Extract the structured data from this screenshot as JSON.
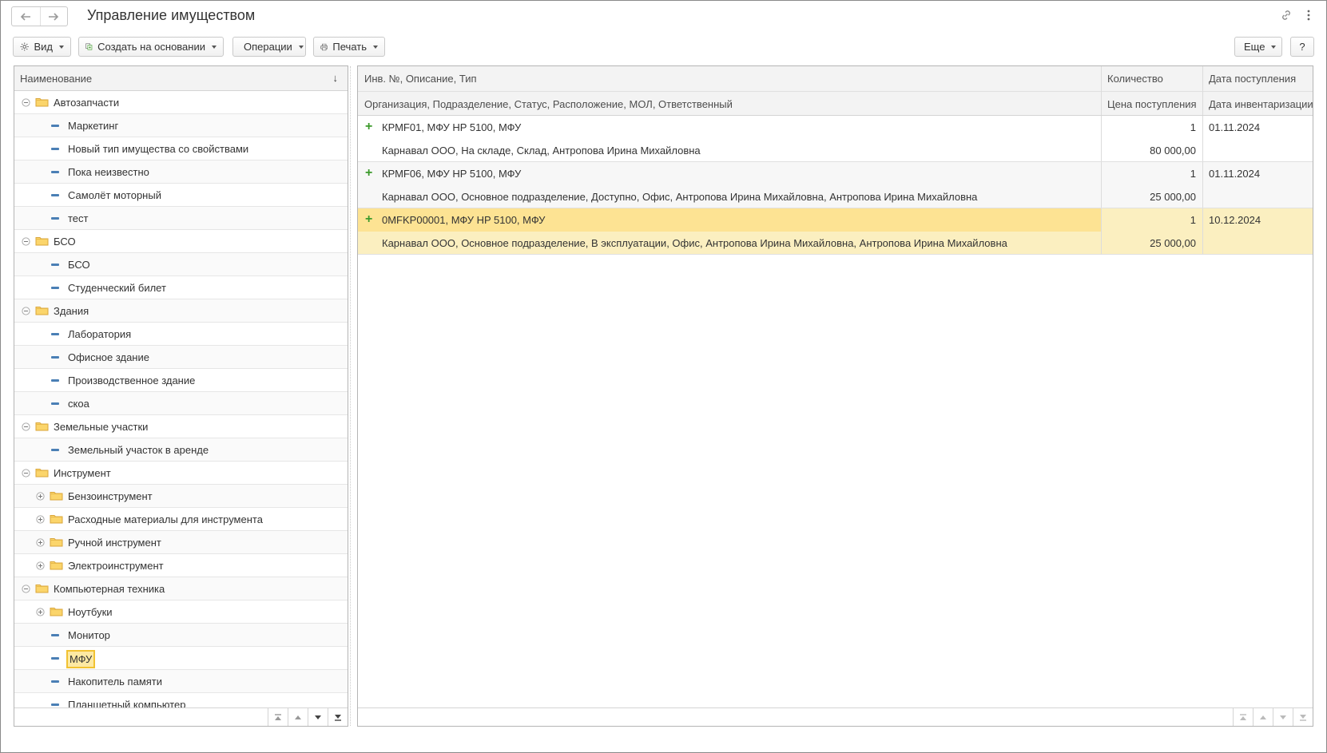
{
  "window": {
    "title": "Управление имуществом"
  },
  "toolbar": {
    "view_label": "Вид",
    "create_based_label": "Создать на основании",
    "operations_label": "Операции",
    "print_label": "Печать",
    "more_label": "Еще",
    "help_label": "?"
  },
  "tree": {
    "header": "Наименование",
    "sort_indicator": "↓",
    "items": [
      {
        "level": 0,
        "type": "folder",
        "state": "expanded",
        "label": "Автозапчасти"
      },
      {
        "level": 1,
        "type": "item",
        "label": "Маркетинг"
      },
      {
        "level": 1,
        "type": "item",
        "label": "Новый тип имущества со свойствами"
      },
      {
        "level": 1,
        "type": "item",
        "label": "Пока неизвестно"
      },
      {
        "level": 1,
        "type": "item",
        "label": "Самолёт моторный"
      },
      {
        "level": 1,
        "type": "item",
        "label": "тест"
      },
      {
        "level": 0,
        "type": "folder",
        "state": "expanded",
        "label": "БСО"
      },
      {
        "level": 1,
        "type": "item",
        "label": "БСО"
      },
      {
        "level": 1,
        "type": "item",
        "label": "Студенческий билет"
      },
      {
        "level": 0,
        "type": "folder",
        "state": "expanded",
        "label": "Здания"
      },
      {
        "level": 1,
        "type": "item",
        "label": "Лаборатория"
      },
      {
        "level": 1,
        "type": "item",
        "label": "Офисное здание"
      },
      {
        "level": 1,
        "type": "item",
        "label": "Производственное здание"
      },
      {
        "level": 1,
        "type": "item",
        "label": "скоа"
      },
      {
        "level": 0,
        "type": "folder",
        "state": "expanded",
        "label": "Земельные участки"
      },
      {
        "level": 1,
        "type": "item",
        "label": "Земельный участок в аренде"
      },
      {
        "level": 0,
        "type": "folder",
        "state": "expanded",
        "label": "Инструмент"
      },
      {
        "level": 1,
        "type": "folder",
        "state": "collapsed",
        "label": "Бензоинструмент"
      },
      {
        "level": 1,
        "type": "folder",
        "state": "collapsed",
        "label": "Расходные материалы для инструмента"
      },
      {
        "level": 1,
        "type": "folder",
        "state": "collapsed",
        "label": "Ручной инструмент"
      },
      {
        "level": 1,
        "type": "folder",
        "state": "collapsed",
        "label": "Электроинструмент"
      },
      {
        "level": 0,
        "type": "folder",
        "state": "expanded",
        "label": "Компьютерная техника"
      },
      {
        "level": 1,
        "type": "folder",
        "state": "collapsed",
        "label": "Ноутбуки"
      },
      {
        "level": 1,
        "type": "item",
        "label": "Монитор"
      },
      {
        "level": 1,
        "type": "item",
        "label": "МФУ",
        "selected": true
      },
      {
        "level": 1,
        "type": "item",
        "label": "Накопитель памяти"
      },
      {
        "level": 1,
        "type": "item",
        "label": "Планшетный компьютер"
      },
      {
        "level": 1,
        "type": "item",
        "label": ""
      }
    ]
  },
  "table": {
    "headers": {
      "row1": {
        "desc": "Инв. №, Описание, Тип",
        "qty": "Количество",
        "date": "Дата поступления"
      },
      "row2": {
        "desc": "Организация, Подразделение, Статус, Расположение, МОЛ, Ответственный",
        "qty": "Цена поступления",
        "date": "Дата инвентаризации"
      }
    },
    "records": [
      {
        "line1": "КРМF01, МФУ HP 5100, МФУ",
        "qty": "1",
        "date_received": "01.11.2024",
        "line2": "Карнавал ООО, На складе, Склад, Антропова Ирина Михайловна",
        "price": "80 000,00",
        "date_inventory": ""
      },
      {
        "line1": "КРМF06, МФУ HP 5100, МФУ",
        "qty": "1",
        "date_received": "01.11.2024",
        "line2": "Карнавал ООО, Основное подразделение, Доступно, Офис, Антропова Ирина Михайловна, Антропова Ирина Михайловна",
        "price": "25 000,00",
        "date_inventory": ""
      },
      {
        "line1": "0MFKP00001, МФУ HP 5100, МФУ",
        "qty": "1",
        "date_received": "10.12.2024",
        "line2": "Карнавал ООО, Основное подразделение, В эксплуатации, Офис, Антропова Ирина Михайловна, Антропова Ирина Михайловна",
        "price": "25 000,00",
        "date_inventory": "",
        "selected": true
      }
    ]
  }
}
